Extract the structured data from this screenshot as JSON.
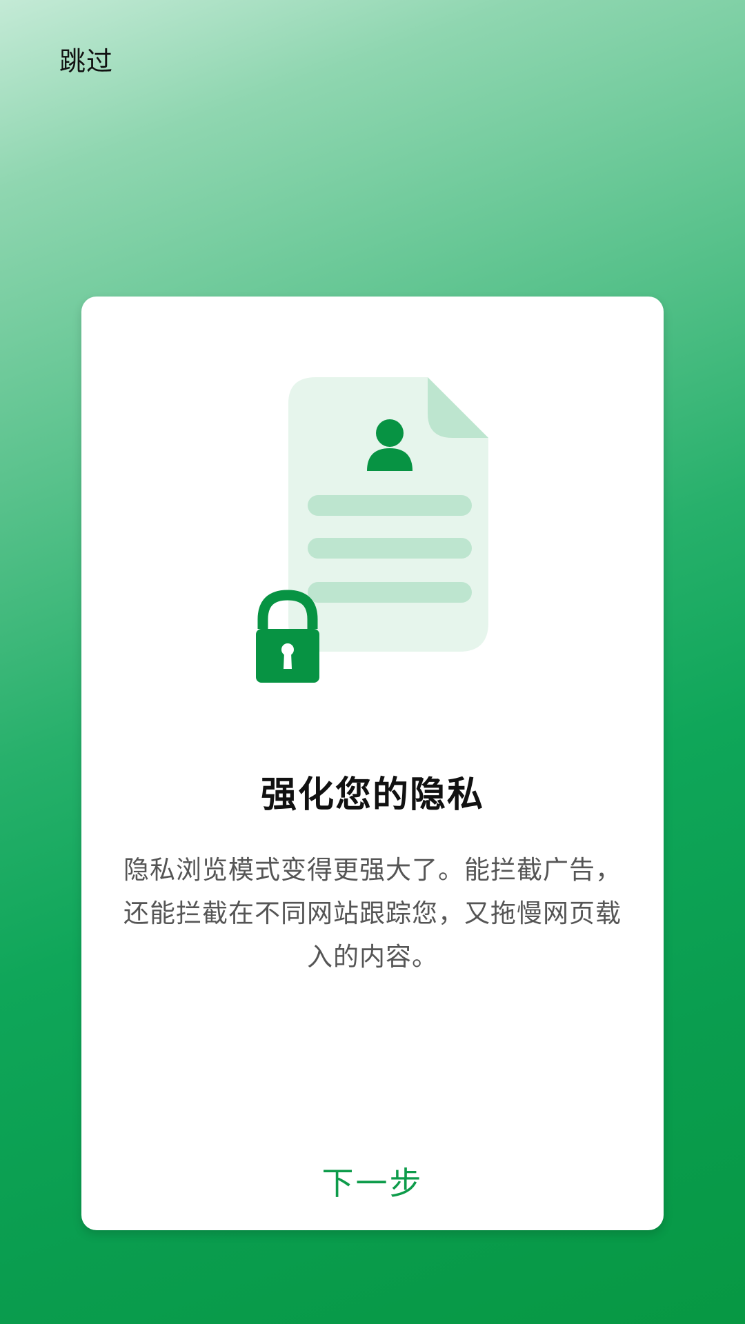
{
  "skip_label": "跳过",
  "card": {
    "title": "强化您的隐私",
    "description": "隐私浏览模式变得更强大了。能拦截广告，还能拦截在不同网站跟踪您，又拖慢网页载入的内容。",
    "next_label": "下一步"
  },
  "colors": {
    "accent": "#0d9b4a",
    "document_fill": "#e6f5ec",
    "document_lines": "#bde5cf",
    "lock": "#079343"
  },
  "icons": [
    "document-icon",
    "person-icon",
    "lock-icon"
  ]
}
